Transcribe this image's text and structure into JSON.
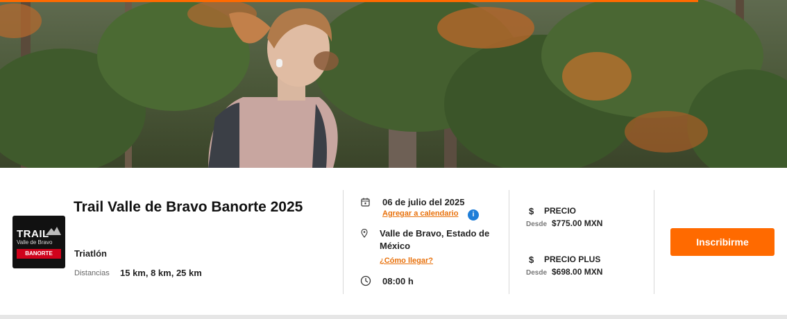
{
  "event": {
    "title": "Trail Valle de Bravo Banorte 2025",
    "category": "Triatlón",
    "distances_label": "Distancias",
    "distances_value": "15 km, 8 km, 25 km"
  },
  "logo": {
    "line1": "TRAIL",
    "line2": "Valle de Bravo",
    "sponsor": "BANORTE"
  },
  "schedule": {
    "date": "06 de julio del 2025",
    "add_to_calendar": "Agregar a calendario",
    "info_glyph": "i",
    "location": "Valle de Bravo, Estado de México",
    "directions": "¿Cómo llegar?",
    "time": "08:00 h"
  },
  "prices": [
    {
      "label": "PRECIO",
      "from": "Desde",
      "value": "$775.00 MXN"
    },
    {
      "label": "PRECIO PLUS",
      "from": "Desde",
      "value": "$698.00 MXN"
    }
  ],
  "cta": {
    "label": "Inscribirme"
  },
  "icons": {
    "calendar": "calendar-icon",
    "location": "map-pin-icon",
    "clock": "clock-icon",
    "currency": "dollar-icon"
  },
  "colors": {
    "accent": "#ff6a00",
    "link": "#e8700a",
    "info": "#1f7ed8",
    "text": "#222222"
  }
}
